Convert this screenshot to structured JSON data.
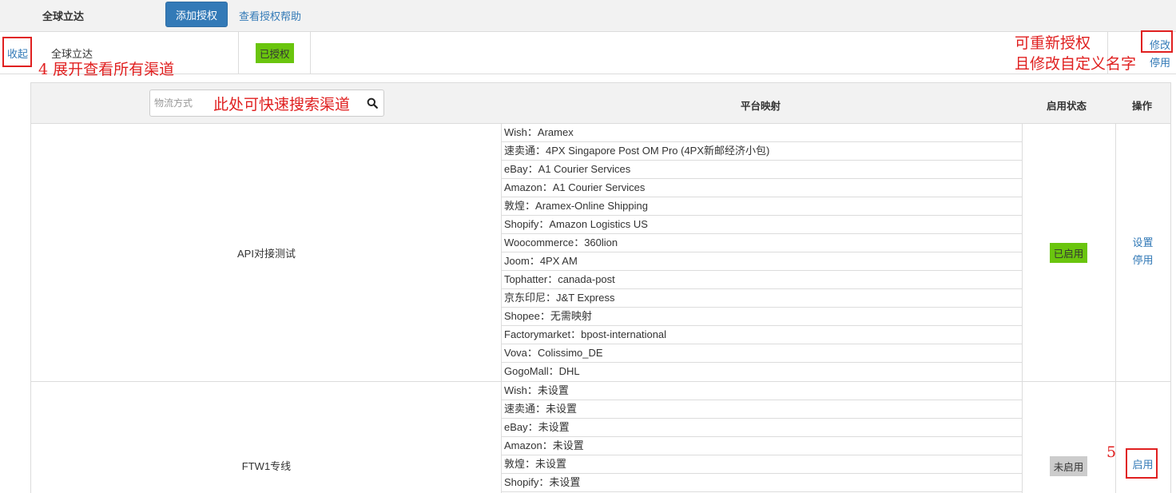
{
  "toolbar": {
    "brand": "全球立达",
    "add_button": "添加授权",
    "help_link": "查看授权帮助"
  },
  "account": {
    "collapse_link": "收起",
    "name": "全球立达",
    "auth_status": "已授权",
    "modify_link": "修改",
    "disable_link": "停用"
  },
  "table": {
    "search_placeholder": "物流方式",
    "headers": {
      "mapping": "平台映射",
      "status": "启用状态",
      "ops": "操作"
    },
    "rows": [
      {
        "name": "API对接测试",
        "mappings": [
          {
            "platform": "Wish",
            "value": "Aramex"
          },
          {
            "platform": "速卖通",
            "value": "4PX Singapore Post OM Pro (4PX新邮经济小包)"
          },
          {
            "platform": "eBay",
            "value": "A1 Courier Services"
          },
          {
            "platform": "Amazon",
            "value": "A1 Courier Services"
          },
          {
            "platform": "敦煌",
            "value": "Aramex-Online Shipping"
          },
          {
            "platform": "Shopify",
            "value": "Amazon Logistics US"
          },
          {
            "platform": "Woocommerce",
            "value": "360lion"
          },
          {
            "platform": "Joom",
            "value": "4PX AM"
          },
          {
            "platform": "Tophatter",
            "value": "canada-post"
          },
          {
            "platform": "京东印尼",
            "value": "J&T Express"
          },
          {
            "platform": "Shopee",
            "value": "无需映射"
          },
          {
            "platform": "Factorymarket",
            "value": "bpost-international"
          },
          {
            "platform": "Vova",
            "value": "Colissimo_DE"
          },
          {
            "platform": "GogoMall",
            "value": "DHL"
          }
        ],
        "status": "已启用",
        "ops": [
          "设置",
          "停用"
        ]
      },
      {
        "name": "FTW1专线",
        "mappings": [
          {
            "platform": "Wish",
            "value": "未设置"
          },
          {
            "platform": "速卖通",
            "value": "未设置"
          },
          {
            "platform": "eBay",
            "value": "未设置"
          },
          {
            "platform": "Amazon",
            "value": "未设置"
          },
          {
            "platform": "敦煌",
            "value": "未设置"
          },
          {
            "platform": "Shopify",
            "value": "未设置"
          }
        ],
        "status": "未启用",
        "ops": [
          "启用"
        ]
      }
    ]
  },
  "annotations": {
    "step4": "4 展开查看所有渠道",
    "search_hint": "此处可快速搜索渠道",
    "reauth_line1": "可重新授权",
    "reauth_line2": "且修改自定义名字",
    "step5": "5"
  },
  "colors": {
    "primary": "#337ab7",
    "enabled_badge": "#6ac50e",
    "disabled_badge": "#cccccc",
    "annotation": "#e02020"
  }
}
